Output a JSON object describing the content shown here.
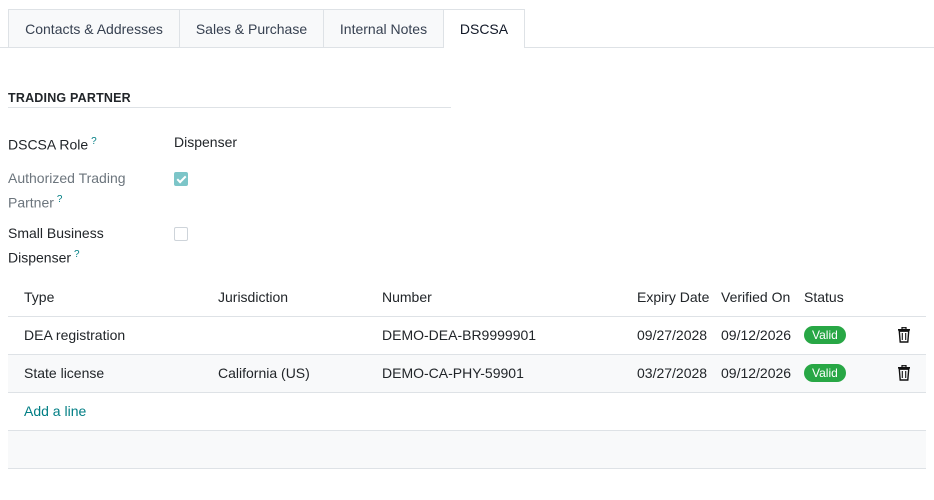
{
  "tabs": [
    "Contacts & Addresses",
    "Sales & Purchase",
    "Internal Notes",
    "DSCSA"
  ],
  "active_tab": "DSCSA",
  "section": {
    "title": "TRADING PARTNER"
  },
  "fields": {
    "dscsa_role": {
      "label": "DSCSA Role",
      "help": "?",
      "value": "Dispenser"
    },
    "authorized_trading_partner": {
      "label_line1": "Authorized Trading",
      "label_line2": "Partner",
      "help": "?",
      "checked": true
    },
    "small_business_dispenser": {
      "label_line1": "Small Business",
      "label_line2": "Dispenser",
      "help": "?",
      "checked": false
    }
  },
  "table": {
    "headers": [
      "Type",
      "Jurisdiction",
      "Number",
      "Expiry Date",
      "Verified On",
      "Status"
    ],
    "rows": [
      {
        "type": "DEA registration",
        "jurisdiction": "",
        "number": "DEMO-DEA-BR9999901",
        "expiry": "09/27/2028",
        "verified": "09/12/2026",
        "status": "Valid"
      },
      {
        "type": "State license",
        "jurisdiction": "California (US)",
        "number": "DEMO-CA-PHY-59901",
        "expiry": "03/27/2028",
        "verified": "09/12/2026",
        "status": "Valid"
      }
    ],
    "add_line": "Add a line"
  },
  "colors": {
    "accent": "#017e84",
    "valid_badge": "#28a745",
    "checkbox_checked": "#7cc5c8"
  },
  "icons": {
    "delete": "trash-icon"
  }
}
